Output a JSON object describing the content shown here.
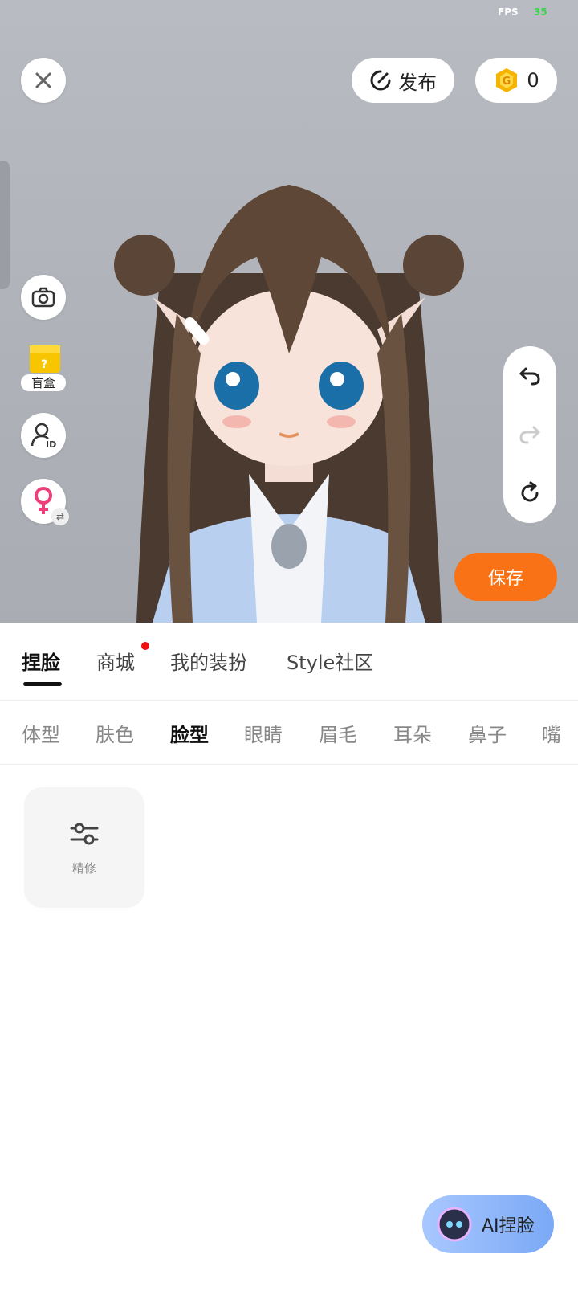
{
  "status": {
    "fps_label": "FPS",
    "fps_value": "35"
  },
  "top_bar": {
    "close_icon": "close-icon",
    "publish_label": "发布",
    "coin_count": "0"
  },
  "left_tools": {
    "blind_box_label": "盲盒"
  },
  "save_label": "保存",
  "tabs": [
    {
      "label": "捏脸"
    },
    {
      "label": "商城"
    },
    {
      "label": "我的装扮"
    },
    {
      "label": "Style社区"
    }
  ],
  "categories": [
    {
      "label": "体型"
    },
    {
      "label": "肤色"
    },
    {
      "label": "脸型"
    },
    {
      "label": "眼睛"
    },
    {
      "label": "眉毛"
    },
    {
      "label": "耳朵"
    },
    {
      "label": "鼻子"
    },
    {
      "label": "嘴"
    }
  ],
  "option_card": {
    "label": "精修"
  },
  "ai_button": {
    "label": "AI捏脸"
  },
  "colors": {
    "accent": "#f97316",
    "coin": "#f5b400"
  }
}
